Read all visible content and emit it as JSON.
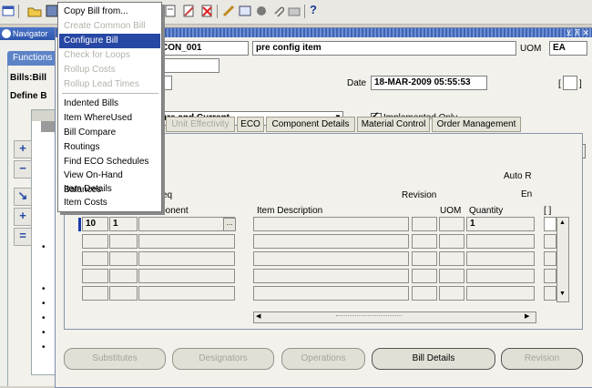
{
  "toolbar": {
    "help_glyph": "?"
  },
  "navigator": {
    "title": "Navigator",
    "functions_tab": "Functions",
    "heading1": "Bills:Bill",
    "heading2": "Define B"
  },
  "header": {
    "item_value": "CON_001",
    "item_desc": "pre config item",
    "uom_label": "UOM",
    "uom_value": "EA",
    "date_label": "Date",
    "date_value": "18-MAR-2009 05:55:53",
    "date_bracket": "[ ]",
    "revisions_value": "ure and Current",
    "implemented_only": "Implemented Only"
  },
  "tabs": [
    "Unit Effectivity",
    "ECO",
    "Component Details",
    "Material Control",
    "Order Management"
  ],
  "grid": {
    "auto_label": "Auto R",
    "eng_label": "En",
    "seq_label": "eq",
    "revision_label": "Revision",
    "component_label": "Component",
    "item_desc_label": "Item Description",
    "uom_label": "UOM",
    "quantity_label": "Quantity",
    "bracket_label": "[ ]",
    "row1": {
      "seq": "10",
      "op": "1",
      "component": "",
      "quantity": "1"
    },
    "ellipsis": "..."
  },
  "buttons": {
    "substitutes": "Substitutes",
    "designators": "Designators",
    "operations": "Operations",
    "bill_details": "Bill Details",
    "revision": "Revision"
  },
  "menu": {
    "items": [
      "Copy Bill from...",
      "Create Common Bill",
      "Configure Bill",
      "Check for Loops",
      "Rollup Costs",
      "Rollup Lead Times",
      "Indented Bills",
      "Item WhereUsed",
      "Bill Compare",
      "Routings",
      "Find ECO Schedules",
      "View On-Hand Balances",
      "Item Details",
      "Item Costs"
    ]
  },
  "colors": {
    "selection": "#2747a4",
    "required_field": "#f9f0a8",
    "titlebar": "#3e64b7"
  }
}
